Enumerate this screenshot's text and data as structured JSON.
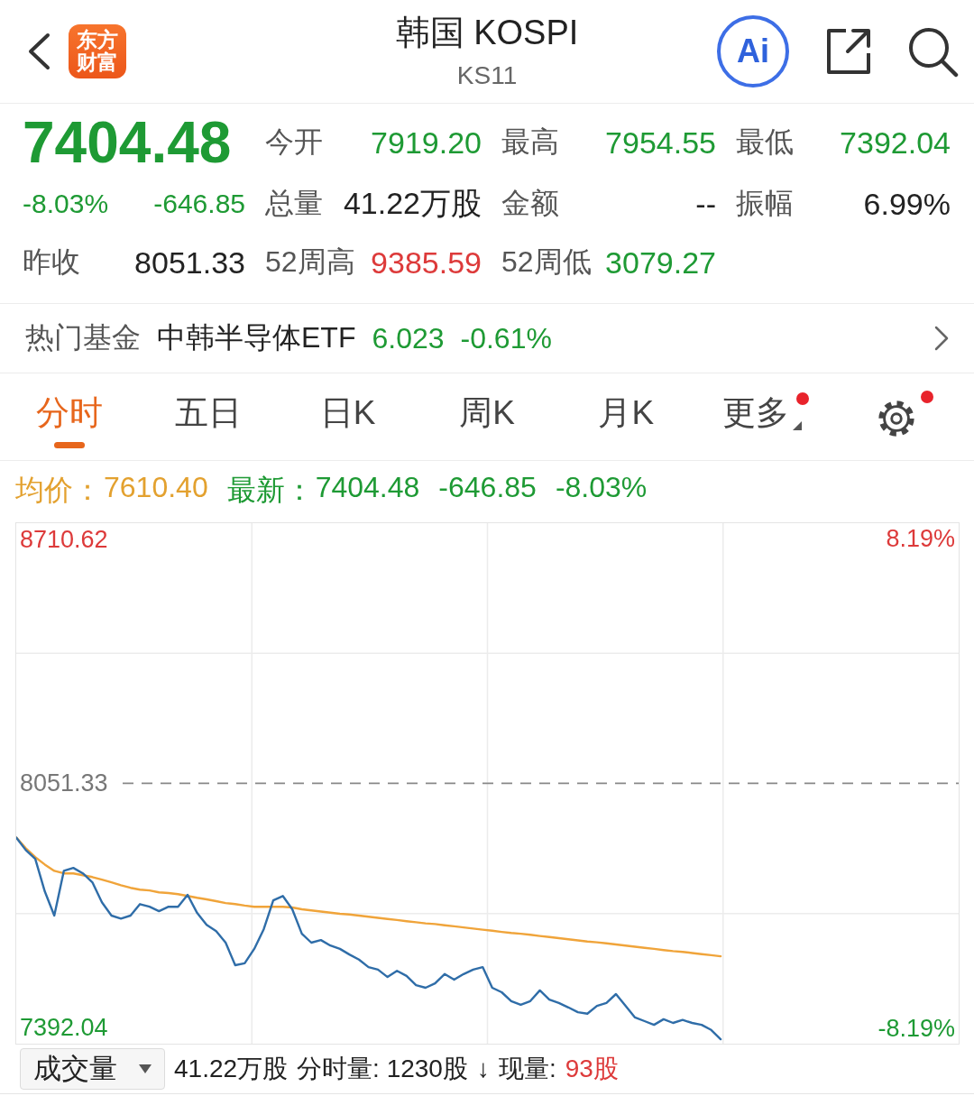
{
  "header": {
    "logo": "东方财富",
    "title": "韩国 KOSPI",
    "subtitle": "KS11",
    "ai_label": "Ai"
  },
  "quote": {
    "price": "7404.48",
    "change_pct": "-8.03%",
    "change": "-646.85",
    "color": "#1e9a34"
  },
  "stats": [
    [
      {
        "label": "今开",
        "value": "7919.20",
        "color": "#1e9a34"
      },
      {
        "label": "最高",
        "value": "7954.55",
        "color": "#1e9a34"
      },
      {
        "label": "最低",
        "value": "7392.04",
        "color": "#1e9a34"
      }
    ],
    [
      {
        "label": "总量",
        "value": "41.22万股",
        "color": "#222222"
      },
      {
        "label": "金额",
        "value": "--",
        "color": "#222222"
      },
      {
        "label": "振幅",
        "value": "6.99%",
        "color": "#222222"
      }
    ],
    [
      {
        "label": "昨收",
        "value": "8051.33",
        "color": "#222222"
      },
      {
        "label": "52周高",
        "value": "9385.59",
        "color": "#dd3a3a"
      },
      {
        "label": "52周低",
        "value": "3079.27",
        "color": "#1e9a34"
      }
    ]
  ],
  "fund": {
    "label": "热门基金",
    "name": "中韩半导体ETF",
    "price": "6.023",
    "change": "-0.61%",
    "color": "#1e9a34"
  },
  "tabs": [
    {
      "kind": "text",
      "label": "分时",
      "selected": true,
      "dot": false
    },
    {
      "kind": "text",
      "label": "五日",
      "selected": false,
      "dot": false
    },
    {
      "kind": "text",
      "label": "日K",
      "selected": false,
      "dot": false
    },
    {
      "kind": "text",
      "label": "周K",
      "selected": false,
      "dot": false
    },
    {
      "kind": "text",
      "label": "月K",
      "selected": false,
      "dot": false
    },
    {
      "kind": "menu",
      "label": "更多",
      "selected": false,
      "dot": true
    },
    {
      "kind": "settings",
      "selected": false,
      "dot": true
    }
  ],
  "legend": [
    {
      "label": "均价：",
      "values": [
        "7610.40"
      ],
      "color": "#e3a12f"
    },
    {
      "label": "最新：",
      "values": [
        "7404.48",
        "-646.85",
        "-8.03%"
      ],
      "color": "#1e9a34"
    }
  ],
  "chart": {
    "right_labels": [
      {
        "label": "8.19%",
        "color": "#dd3a3a"
      },
      {
        "label": "-8.19%",
        "color": "#1e9a34"
      }
    ],
    "chart_data": {
      "type": "line",
      "ylim": [
        7348,
        8754
      ],
      "yticks": [
        {
          "value": 8710.62,
          "label": "8710.62"
        },
        {
          "value": 7392.04,
          "label": "7392.04"
        }
      ],
      "ref_lines": [
        {
          "axis": "y",
          "value": 8051.33,
          "label": "8051.33"
        }
      ],
      "series": [
        {
          "color": "#f0a43a",
          "values": [
            7905,
            7876,
            7852,
            7832,
            7815,
            7808,
            7808,
            7803,
            7798,
            7791,
            7784,
            7776,
            7769,
            7764,
            7762,
            7757,
            7755,
            7752,
            7747,
            7742,
            7738,
            7733,
            7728,
            7725,
            7721,
            7718,
            7718,
            7718,
            7718,
            7716,
            7711,
            7708,
            7705,
            7702,
            7699,
            7697,
            7694,
            7691,
            7688,
            7685,
            7682,
            7679,
            7676,
            7673,
            7671,
            7668,
            7665,
            7662,
            7659,
            7656,
            7653,
            7650,
            7647,
            7645,
            7642,
            7639,
            7636,
            7633,
            7630,
            7627,
            7624,
            7622,
            7619,
            7616,
            7613,
            7610,
            7607,
            7604,
            7601,
            7598,
            7596,
            7593,
            7590,
            7587,
            7584,
            null,
            null,
            null,
            null,
            null,
            null,
            null,
            null,
            null,
            null,
            null,
            null,
            null,
            null,
            null,
            null,
            null,
            null,
            null,
            null,
            null,
            null,
            null,
            null,
            null
          ]
        },
        {
          "color": "#2f6da8",
          "values": [
            7905,
            7871,
            7847,
            7759,
            7694,
            7815,
            7823,
            7808,
            7784,
            7730,
            7694,
            7686,
            7694,
            7725,
            7718,
            7706,
            7718,
            7718,
            7750,
            7701,
            7669,
            7652,
            7621,
            7560,
            7565,
            7604,
            7657,
            7735,
            7747,
            7711,
            7645,
            7621,
            7628,
            7613,
            7604,
            7589,
            7575,
            7555,
            7548,
            7528,
            7545,
            7531,
            7506,
            7499,
            7511,
            7536,
            7521,
            7536,
            7548,
            7555,
            7499,
            7487,
            7463,
            7453,
            7463,
            7492,
            7467,
            7458,
            7446,
            7433,
            7429,
            7450,
            7458,
            7482,
            7450,
            7419,
            7409,
            7399,
            7414,
            7404,
            7412,
            7404,
            7399,
            7385,
            7360,
            null,
            null,
            null,
            null,
            null,
            null,
            null,
            null,
            null,
            null,
            null,
            null,
            null,
            null,
            null,
            null,
            null,
            null,
            null,
            null,
            null,
            null,
            null,
            null,
            null
          ]
        }
      ]
    }
  },
  "volume": {
    "selector": "成交量",
    "items": [
      {
        "text": "41.22万股",
        "color": "#222222"
      },
      {
        "text": "分时量: 1230股",
        "color": "#222222"
      },
      {
        "text": "↓",
        "color": "#222222"
      },
      {
        "text": "现量:",
        "color": "#222222"
      },
      {
        "text": "93股",
        "color": "#dd3a3a"
      }
    ]
  }
}
